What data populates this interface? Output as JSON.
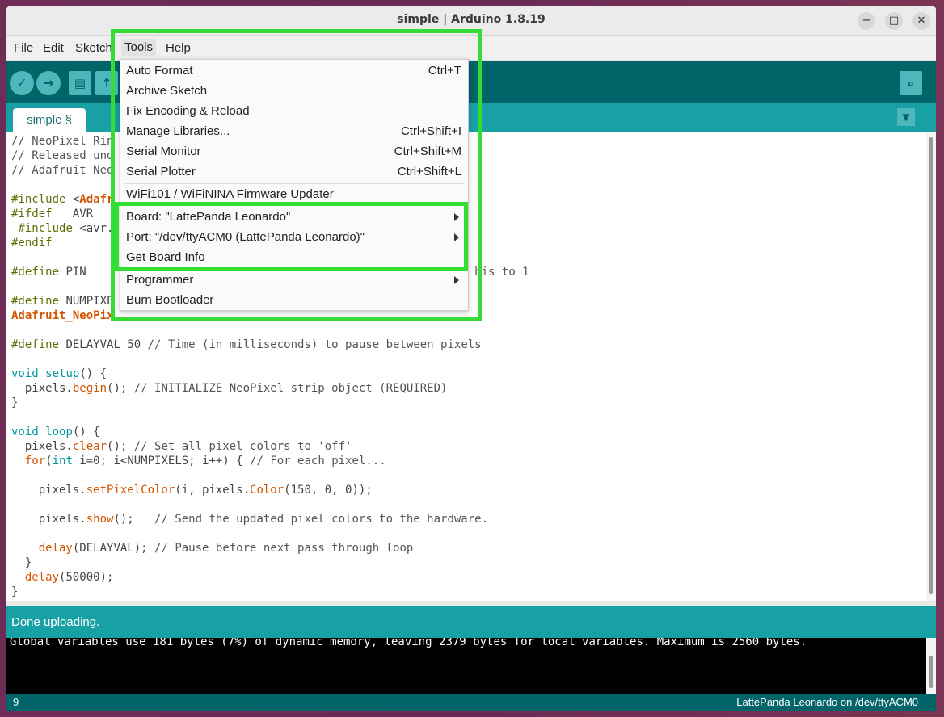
{
  "window": {
    "title": "simple | Arduino 1.8.19",
    "controls": {
      "minimize": "−",
      "maximize": "□",
      "close": "✕"
    }
  },
  "menubar": {
    "items": [
      "File",
      "Edit",
      "Sketch",
      "Tools",
      "Help"
    ],
    "active": "Tools"
  },
  "toolbar": {
    "buttons": [
      {
        "name": "verify",
        "icon": "check-icon",
        "glyph": "✓"
      },
      {
        "name": "upload",
        "icon": "arrow-right-icon",
        "glyph": "→"
      },
      {
        "name": "new",
        "icon": "file-icon",
        "glyph": "▤"
      },
      {
        "name": "open",
        "icon": "arrow-up-icon",
        "glyph": "↑"
      },
      {
        "name": "serial-monitor",
        "icon": "magnifier-icon",
        "glyph": "⌕"
      }
    ]
  },
  "tabs": {
    "current": "simple §",
    "menu_glyph": "▼"
  },
  "tools_menu": {
    "items": [
      {
        "label": "Auto Format",
        "shortcut": "Ctrl+T"
      },
      {
        "label": "Archive Sketch",
        "shortcut": ""
      },
      {
        "label": "Fix Encoding & Reload",
        "shortcut": ""
      },
      {
        "label": "Manage Libraries...",
        "shortcut": "Ctrl+Shift+I"
      },
      {
        "label": "Serial Monitor",
        "shortcut": "Ctrl+Shift+M"
      },
      {
        "label": "Serial Plotter",
        "shortcut": "Ctrl+Shift+L"
      },
      {
        "label": "WiFi101 / WiFiNINA Firmware Updater",
        "shortcut": ""
      },
      {
        "label": "Board: \"LattePanda Leonardo\"",
        "submenu": true
      },
      {
        "label": "Port: \"/dev/ttyACM0 (LattePanda Leonardo)\"",
        "submenu": true
      },
      {
        "label": "Get Board Info",
        "shortcut": ""
      },
      {
        "label": "Programmer",
        "submenu": true
      },
      {
        "label": "Burn Bootloader",
        "shortcut": ""
      }
    ]
  },
  "editor": {
    "lines": [
      {
        "segments": [
          [
            "comment",
            "// NeoPixel Rin"
          ]
        ]
      },
      {
        "segments": [
          [
            "comment",
            "// Released und"
          ]
        ]
      },
      {
        "segments": [
          [
            "comment",
            "// Adafruit Neo"
          ]
        ]
      },
      {
        "segments": []
      },
      {
        "segments": [
          [
            "pre",
            "#include"
          ],
          [
            "plain",
            " <"
          ],
          [
            "type",
            "Adafr"
          ]
        ]
      },
      {
        "segments": [
          [
            "pre",
            "#ifdef"
          ],
          [
            "plain",
            " __AVR__"
          ]
        ]
      },
      {
        "segments": [
          [
            "plain",
            " "
          ],
          [
            "pre",
            "#include"
          ],
          [
            "plain",
            " <avr."
          ]
        ]
      },
      {
        "segments": [
          [
            "pre",
            "#endif"
          ]
        ]
      },
      {
        "segments": []
      },
      {
        "segments": [
          [
            "pre",
            "#define"
          ],
          [
            "plain",
            " PIN"
          ],
          [
            "plain",
            "                                                         "
          ],
          [
            "comment",
            "his to 1"
          ]
        ]
      },
      {
        "segments": []
      },
      {
        "segments": [
          [
            "pre",
            "#define"
          ],
          [
            "plain",
            " NUMPIXE"
          ]
        ]
      },
      {
        "segments": [
          [
            "type",
            "Adafruit_NeoPix"
          ]
        ]
      },
      {
        "segments": []
      },
      {
        "segments": [
          [
            "pre",
            "#define"
          ],
          [
            "plain",
            " DELAYVAL 50 "
          ],
          [
            "comment",
            "// Time (in milliseconds) to pause between pixels"
          ]
        ]
      },
      {
        "segments": []
      },
      {
        "segments": [
          [
            "kw",
            "void"
          ],
          [
            "plain",
            " "
          ],
          [
            "kw",
            "setup"
          ],
          [
            "plain",
            "() {"
          ]
        ]
      },
      {
        "segments": [
          [
            "plain",
            "  pixels."
          ],
          [
            "fn",
            "begin"
          ],
          [
            "plain",
            "(); "
          ],
          [
            "comment",
            "// INITIALIZE NeoPixel strip object (REQUIRED)"
          ]
        ]
      },
      {
        "segments": [
          [
            "plain",
            "}"
          ]
        ]
      },
      {
        "segments": []
      },
      {
        "segments": [
          [
            "kw",
            "void"
          ],
          [
            "plain",
            " "
          ],
          [
            "kw",
            "loop"
          ],
          [
            "plain",
            "() {"
          ]
        ]
      },
      {
        "segments": [
          [
            "plain",
            "  pixels."
          ],
          [
            "fn",
            "clear"
          ],
          [
            "plain",
            "(); "
          ],
          [
            "comment",
            "// Set all pixel colors to 'off'"
          ]
        ]
      },
      {
        "segments": [
          [
            "plain",
            "  "
          ],
          [
            "fn",
            "for"
          ],
          [
            "plain",
            "("
          ],
          [
            "kw",
            "int"
          ],
          [
            "plain",
            " i=0; i<NUMPIXELS; i++) { "
          ],
          [
            "comment",
            "// For each pixel..."
          ]
        ]
      },
      {
        "segments": []
      },
      {
        "segments": [
          [
            "plain",
            "    pixels."
          ],
          [
            "fn",
            "setPixelColor"
          ],
          [
            "plain",
            "(i, pixels."
          ],
          [
            "fn",
            "Color"
          ],
          [
            "plain",
            "(150, 0, 0));"
          ]
        ]
      },
      {
        "segments": []
      },
      {
        "segments": [
          [
            "plain",
            "    pixels."
          ],
          [
            "fn",
            "show"
          ],
          [
            "plain",
            "();   "
          ],
          [
            "comment",
            "// Send the updated pixel colors to the hardware."
          ]
        ]
      },
      {
        "segments": []
      },
      {
        "segments": [
          [
            "plain",
            "    "
          ],
          [
            "fn",
            "delay"
          ],
          [
            "plain",
            "(DELAYVAL); "
          ],
          [
            "comment",
            "// Pause before next pass through loop"
          ]
        ]
      },
      {
        "segments": [
          [
            "plain",
            "  }"
          ]
        ]
      },
      {
        "segments": [
          [
            "plain",
            "  "
          ],
          [
            "fn",
            "delay"
          ],
          [
            "plain",
            "(50000);"
          ]
        ]
      },
      {
        "segments": [
          [
            "plain",
            "}"
          ]
        ]
      }
    ]
  },
  "status": {
    "message": "Done uploading."
  },
  "console": {
    "line": "Global variables use 181 bytes (7%) of dynamic memory, leaving 2379 bytes for local variables. Maximum is 2560 bytes."
  },
  "footer": {
    "line_number": "9",
    "board": "LattePanda Leonardo on /dev/ttyACM0"
  },
  "colors": {
    "toolbar": "#006468",
    "tabbar": "#17a1a5",
    "highlight": "#33dd33"
  }
}
